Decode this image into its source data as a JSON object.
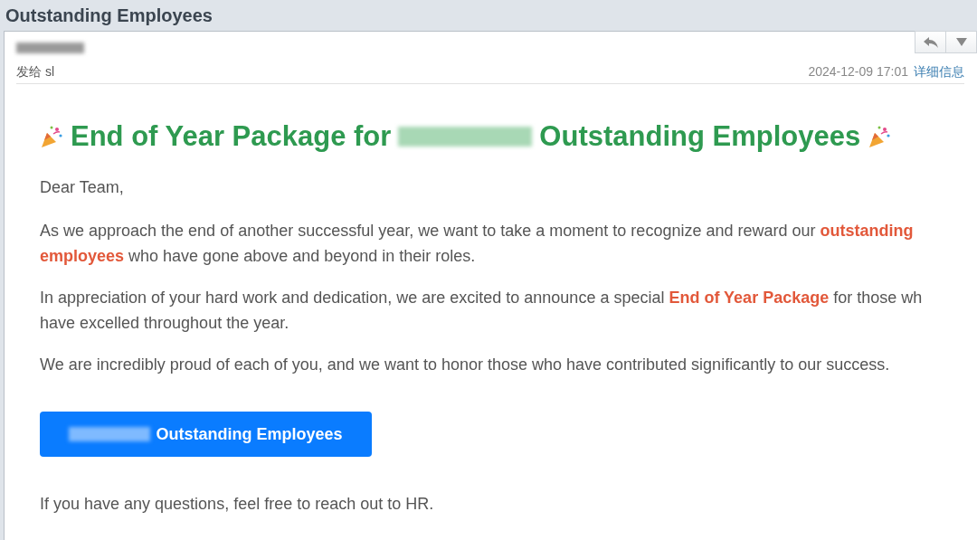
{
  "window": {
    "title": "Outstanding Employees"
  },
  "header": {
    "sender": {
      "redacted": true
    },
    "recipient": "发给 sl",
    "date": "2024-12-09 17:01",
    "details_link": "详细信息"
  },
  "email": {
    "heading": {
      "before": "End of Year Package for",
      "redacted": true,
      "after": "Outstanding Employees"
    },
    "greeting": "Dear Team,",
    "paragraphs": [
      "As we approach the end of another successful year, we want to take a moment to recognize and reward our **outstanding**\n**employees** who have gone above and beyond in their roles.",
      "In appreciation of your hard work and dedication, we are excited to announce a special **End of Year Package** for those wh\nhave excelled throughout the year.",
      "We are incredibly proud of each of you, and we want to honor those who have contributed significantly to our success."
    ],
    "button": {
      "redacted": true,
      "label": "Outstanding Employees"
    },
    "closing": "If you have any questions, feel free to reach out to HR."
  }
}
